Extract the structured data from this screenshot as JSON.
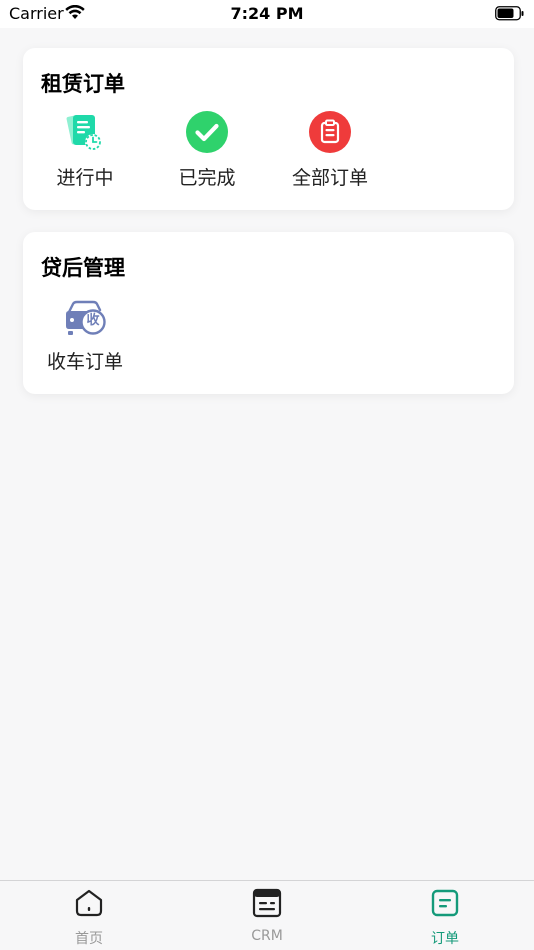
{
  "status_bar": {
    "carrier": "Carrier",
    "time": "7:24 PM",
    "wifi_icon": "wifi-icon",
    "battery_icon": "battery-icon"
  },
  "rental_orders": {
    "title": "租赁订单",
    "items": [
      {
        "label": "进行中",
        "icon": "document-clock-icon",
        "color": "#23d8a8"
      },
      {
        "label": "已完成",
        "icon": "checkmark-circle-icon",
        "color": "#2fd26c"
      },
      {
        "label": "全部订单",
        "icon": "clipboard-icon",
        "color": "#ef3b3b"
      }
    ]
  },
  "post_loan": {
    "title": "贷后管理",
    "items": [
      {
        "label": "收车订单",
        "icon": "car-collect-icon",
        "icon_text": "收",
        "color": "#6f7fb8"
      }
    ]
  },
  "tab_bar": {
    "tabs": [
      {
        "label": "首页",
        "icon": "home-icon"
      },
      {
        "label": "CRM",
        "icon": "crm-icon"
      },
      {
        "label": "订单",
        "icon": "order-icon",
        "active": true
      }
    ],
    "active_color": "#149a7a",
    "inactive_color": "#999999"
  }
}
